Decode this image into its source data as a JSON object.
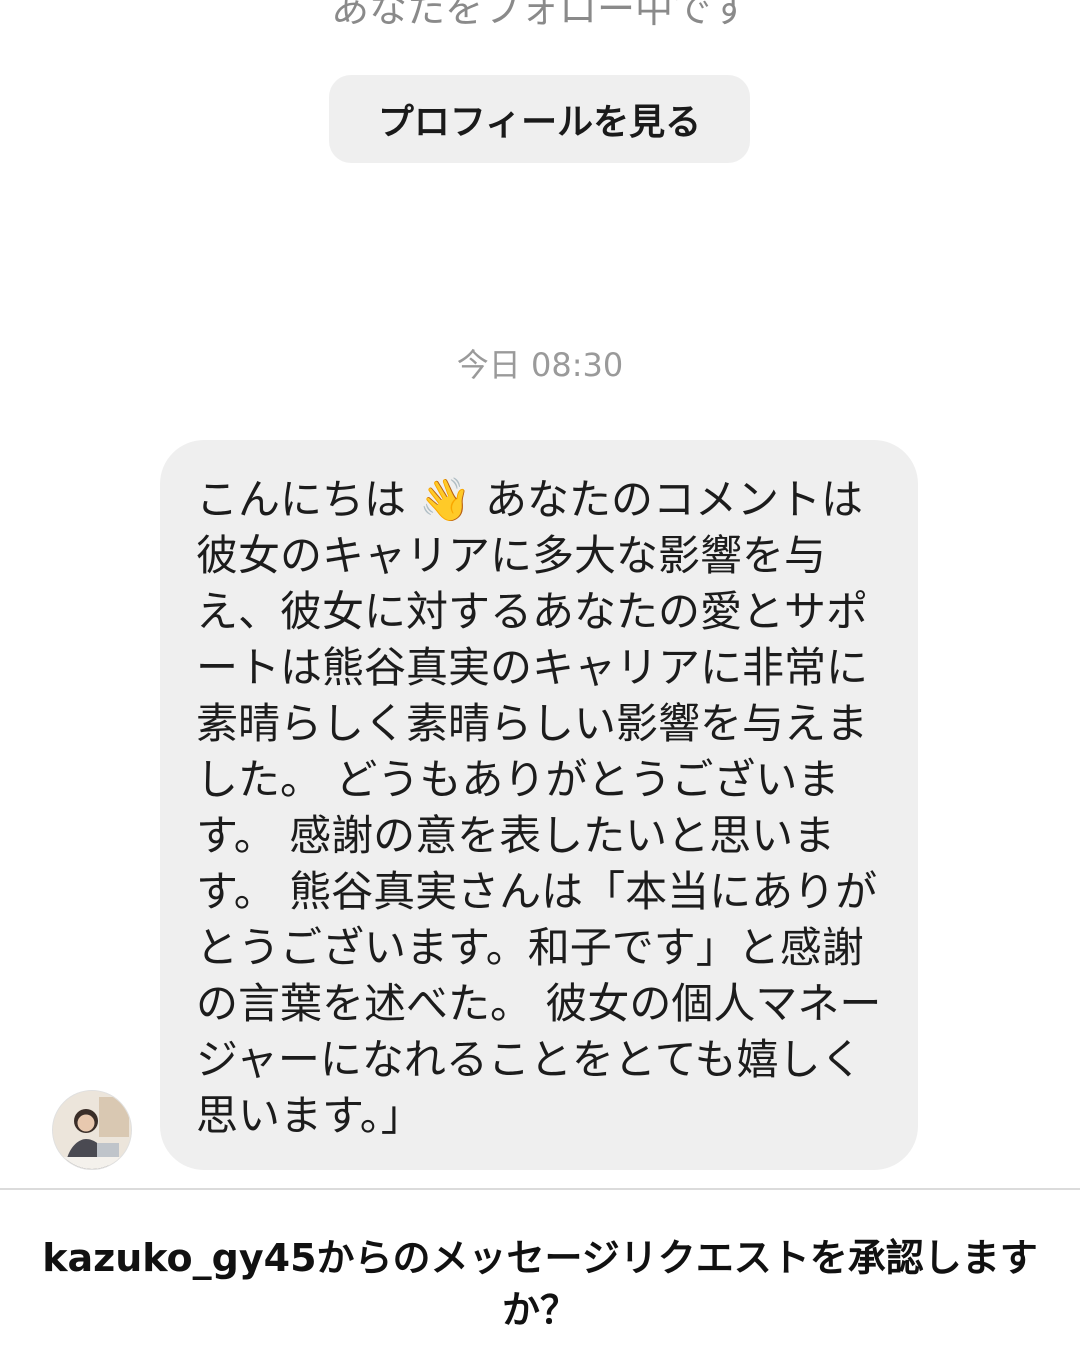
{
  "header": {
    "follow_status": "あなたをフォロー中です",
    "profile_button_label": "プロフィールを見る"
  },
  "thread": {
    "timestamp": "今日 08:30",
    "message": {
      "sender_avatar_icon": "avatar-photo",
      "text": "こんにちは 👋 あなたのコメントは彼女のキャリアに多大な影響を与え、彼女に対するあなたの愛とサポートは熊谷真実のキャリアに非常に素晴らしく素晴らしい影響を与えました。 どうもありがとうございます。 感謝の意を表したいと思います。 熊谷真実さんは「本当にありがとうございます。和子です」と感謝の言葉を述べた。 彼女の個人マネージャーになれることをとても嬉しく思います。」"
    }
  },
  "footer": {
    "request_prompt": "kazuko_gy45からのメッセージリクエストを承認しますか？"
  }
}
